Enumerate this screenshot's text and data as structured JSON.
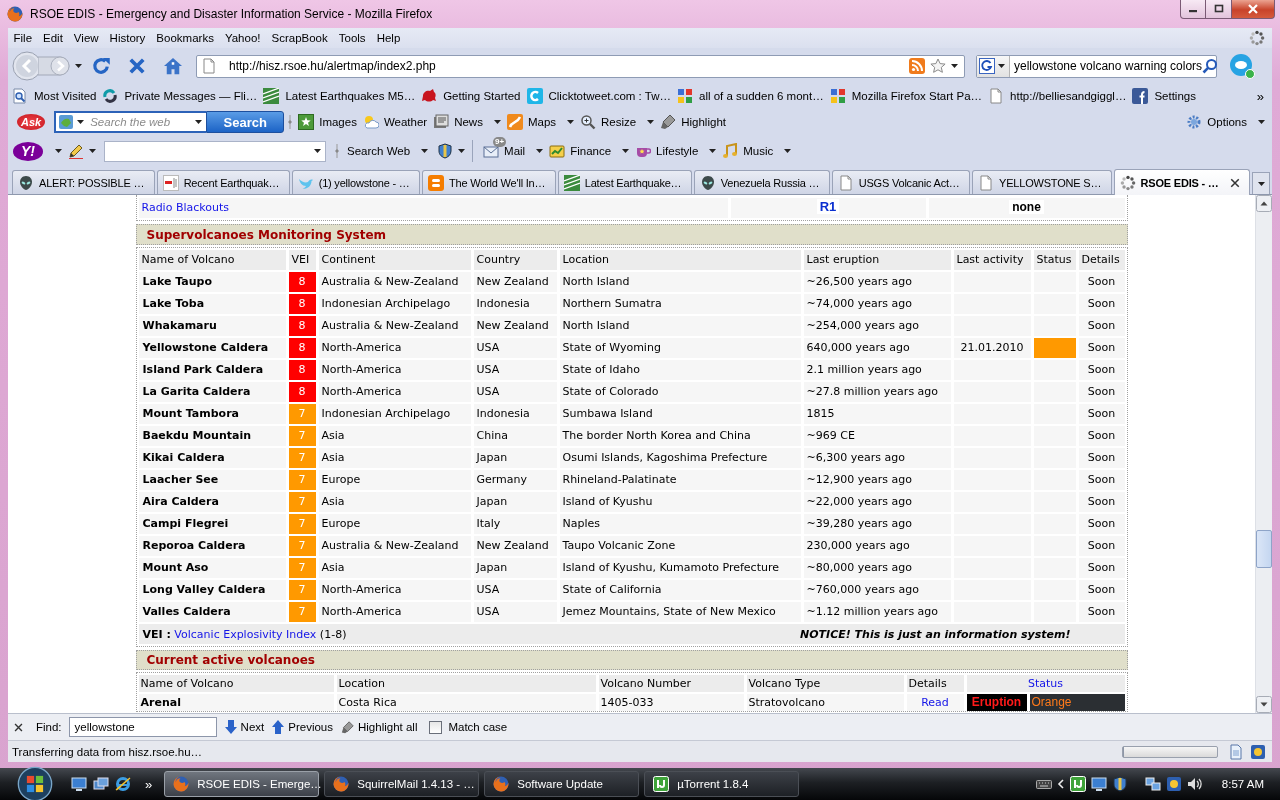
{
  "window": {
    "title": "RSOE EDIS - Emergency and Disaster Information Service - Mozilla Firefox"
  },
  "menu": [
    "File",
    "Edit",
    "View",
    "History",
    "Bookmarks",
    "Yahoo!",
    "ScrapBook",
    "Tools",
    "Help"
  ],
  "navigation": {
    "url": "http://hisz.rsoe.hu/alertmap/index2.php",
    "search": "yellowstone volcano warning colors"
  },
  "bookmarks": {
    "items": [
      {
        "label": "Most Visited",
        "kind": "magnifier"
      },
      {
        "label": "Private Messages — Fli…",
        "kind": "swirl"
      },
      {
        "label": "Latest Earthquakes M5…",
        "kind": "stripes"
      },
      {
        "label": "Getting Started",
        "kind": "creature"
      },
      {
        "label": "Clicktotweet.com : Tw…",
        "kind": "tile"
      },
      {
        "label": "all of a sudden 6 mont…",
        "kind": "blocks"
      },
      {
        "label": "Mozilla Firefox Start Pa…",
        "kind": "blocks"
      },
      {
        "label": "http://belliesandgiggl…",
        "kind": "page"
      },
      {
        "label": "Settings",
        "kind": "letter"
      }
    ],
    "more": "»"
  },
  "ask_toolbar": {
    "logo": "Ask",
    "placeholder": "Search the web",
    "button": "Search",
    "items": [
      {
        "label": "Images",
        "kind": "images",
        "dropdown": false
      },
      {
        "label": "Weather",
        "kind": "weather",
        "dropdown": false
      },
      {
        "label": "News",
        "kind": "news",
        "dropdown": true
      },
      {
        "label": "Maps",
        "kind": "maps",
        "dropdown": true
      },
      {
        "label": "Resize",
        "kind": "resize",
        "dropdown": true
      },
      {
        "label": "Highlight",
        "kind": "highlight",
        "dropdown": false
      }
    ],
    "options": "Options"
  },
  "yahoo_toolbar": {
    "logo": "Y!",
    "button": "Search Web",
    "items": [
      {
        "label": "Mail",
        "kind": "mail",
        "badge": "9+",
        "dropdown": true
      },
      {
        "label": "Finance",
        "kind": "finance",
        "dropdown": true
      },
      {
        "label": "Lifestyle",
        "kind": "lifestyle",
        "dropdown": true
      },
      {
        "label": "Music",
        "kind": "music",
        "dropdown": true
      }
    ]
  },
  "tabs": [
    {
      "label": "ALERT: POSSIBLE …",
      "kind": "head",
      "selected": false
    },
    {
      "label": "Recent Earthquak…",
      "kind": "thumbnail",
      "selected": false
    },
    {
      "label": "(1) yellowstone - …",
      "kind": "bird",
      "selected": false
    },
    {
      "label": "The World We'll In…",
      "kind": "square",
      "selected": false
    },
    {
      "label": "Latest Earthquake…",
      "kind": "stripes",
      "selected": false
    },
    {
      "label": "Venezuela Russia …",
      "kind": "head",
      "selected": false
    },
    {
      "label": "USGS Volcanic Act…",
      "kind": "page",
      "selected": false
    },
    {
      "label": "YELLOWSTONE S…",
      "kind": "page",
      "selected": false
    },
    {
      "label": "RSOE EDIS - …",
      "kind": "spinner",
      "selected": true
    }
  ],
  "page": {
    "radio_row": {
      "label": "Radio Blackouts",
      "scale": "R1",
      "value": "none"
    },
    "supervolcanoes": {
      "title": "Supervolcanoes Monitoring System",
      "columns": [
        "Name of Volcano",
        "VEI",
        "Continent",
        "Country",
        "Location",
        "Last eruption",
        "Last activity",
        "Status",
        "Details"
      ],
      "rows": [
        {
          "name": "Lake Taupo",
          "vei": {
            "value": "8",
            "color": "#ff0000"
          },
          "continent": "Australia & New-Zealand",
          "country": "New Zealand",
          "location": "North Island",
          "last_eruption": "~26,500 years ago",
          "details": "Soon"
        },
        {
          "name": "Lake Toba",
          "vei": {
            "value": "8",
            "color": "#ff0000"
          },
          "continent": "Indonesian Archipelago",
          "country": "Indonesia",
          "location": "Northern Sumatra",
          "last_eruption": "~74,000 years ago",
          "details": "Soon"
        },
        {
          "name": "Whakamaru",
          "vei": {
            "value": "8",
            "color": "#ff0000"
          },
          "continent": "Australia & New-Zealand",
          "country": "New Zealand",
          "location": "North Island",
          "last_eruption": "~254,000 years ago",
          "details": "Soon"
        },
        {
          "name": "Yellowstone Caldera",
          "vei": {
            "value": "8",
            "color": "#ff0000"
          },
          "continent": "North-America",
          "country": "USA",
          "location": "State of Wyoming",
          "last_eruption": "640,000 years ago",
          "last_activity": "21.01.2010",
          "status": {
            "color": "#ff9900"
          },
          "details": "Soon"
        },
        {
          "name": "Island Park Caldera",
          "vei": {
            "value": "8",
            "color": "#ff0000"
          },
          "continent": "North-America",
          "country": "USA",
          "location": "State of Idaho",
          "last_eruption": "2.1 million years ago",
          "details": "Soon"
        },
        {
          "name": "La Garita Caldera",
          "vei": {
            "value": "8",
            "color": "#ff0000"
          },
          "continent": "North-America",
          "country": "USA",
          "location": "State of Colorado",
          "last_eruption": "~27.8 million years ago",
          "details": "Soon"
        },
        {
          "name": "Mount Tambora",
          "vei": {
            "value": "7",
            "color": "#ff9900"
          },
          "continent": "Indonesian Archipelago",
          "country": "Indonesia",
          "location": "Sumbawa Island",
          "last_eruption": "1815",
          "details": "Soon"
        },
        {
          "name": "Baekdu Mountain",
          "vei": {
            "value": "7",
            "color": "#ff9900"
          },
          "continent": "Asia",
          "country": "China",
          "location": "The border North Korea and China",
          "last_eruption": "~969 CE",
          "details": "Soon"
        },
        {
          "name": "Kikai Caldera",
          "vei": {
            "value": "7",
            "color": "#ff9900"
          },
          "continent": "Asia",
          "country": "Japan",
          "location": "Osumi Islands, Kagoshima Prefecture",
          "last_eruption": "~6,300 years ago",
          "details": "Soon"
        },
        {
          "name": "Laacher See",
          "vei": {
            "value": "7",
            "color": "#ff9900"
          },
          "continent": "Europe",
          "country": "Germany",
          "location": "Rhineland-Palatinate",
          "last_eruption": "~12,900 years ago",
          "details": "Soon"
        },
        {
          "name": "Aira Caldera",
          "vei": {
            "value": "7",
            "color": "#ff9900"
          },
          "continent": "Asia",
          "country": "Japan",
          "location": "Island of Kyushu",
          "last_eruption": "~22,000 years ago",
          "details": "Soon"
        },
        {
          "name": "Campi Flegrei",
          "vei": {
            "value": "7",
            "color": "#ff9900"
          },
          "continent": "Europe",
          "country": "Italy",
          "location": "Naples",
          "last_eruption": "~39,280 years ago",
          "details": "Soon"
        },
        {
          "name": "Reporoa Caldera",
          "vei": {
            "value": "7",
            "color": "#ff9900"
          },
          "continent": "Australia & New-Zealand",
          "country": "New Zealand",
          "location": "Taupo Volcanic Zone",
          "last_eruption": "230,000 years ago",
          "details": "Soon"
        },
        {
          "name": "Mount Aso",
          "vei": {
            "value": "7",
            "color": "#ff9900"
          },
          "continent": "Asia",
          "country": "Japan",
          "location": "Island of Kyushu, Kumamoto Prefecture",
          "last_eruption": "~80,000 years ago",
          "details": "Soon"
        },
        {
          "name": "Long Valley Caldera",
          "vei": {
            "value": "7",
            "color": "#ff9900"
          },
          "continent": "North-America",
          "country": "USA",
          "location": "State of California",
          "last_eruption": "~760,000 years ago",
          "details": "Soon"
        },
        {
          "name": "Valles Caldera",
          "vei": {
            "value": "7",
            "color": "#ff9900"
          },
          "continent": "North-America",
          "country": "USA",
          "location": "Jemez Mountains, State of New Mexico",
          "last_eruption": "~1.12 million years ago",
          "details": "Soon"
        }
      ],
      "footer": {
        "label": "VEI :",
        "link": "Volcanic Explosivity Index",
        "range": "(1-8)",
        "notice": "NOTICE! This is just an information system!"
      }
    },
    "active_volcanoes": {
      "title": "Current active volcanoes",
      "columns": [
        {
          "label": "Name of Volcano",
          "link": false
        },
        {
          "label": "Location",
          "link": false
        },
        {
          "label": "Volcano Number",
          "link": false
        },
        {
          "label": "Volcano Type",
          "link": false
        },
        {
          "label": "Details",
          "link": false
        },
        {
          "label": "Status",
          "link": true
        }
      ],
      "rows": [
        {
          "name": "Arenal",
          "location": "Costa Rica",
          "number": "1405-033",
          "type": "Stratovolcano",
          "details": "Read",
          "activity": "Eruption",
          "alert": "Orange"
        }
      ]
    }
  },
  "find_bar": {
    "label": "Find:",
    "value": "yellowstone",
    "next": "Next",
    "previous": "Previous",
    "highlight": "Highlight all",
    "match_case": {
      "label": "Match case",
      "checked": false
    }
  },
  "status_bar": {
    "text": "Transferring data from hisz.rsoe.hu…",
    "level": 0
  },
  "taskbar": {
    "more": "»",
    "tasks": [
      {
        "label": "RSOE EDIS - Emerge…",
        "kind": "firefox",
        "selected": true
      },
      {
        "label": "SquirrelMail 1.4.13 - …",
        "kind": "firefox",
        "selected": false
      },
      {
        "label": "Software Update",
        "kind": "firefox",
        "selected": false
      },
      {
        "label": "µTorrent 1.8.4",
        "kind": "torrent",
        "selected": false
      }
    ],
    "clock": "8:57 AM"
  }
}
